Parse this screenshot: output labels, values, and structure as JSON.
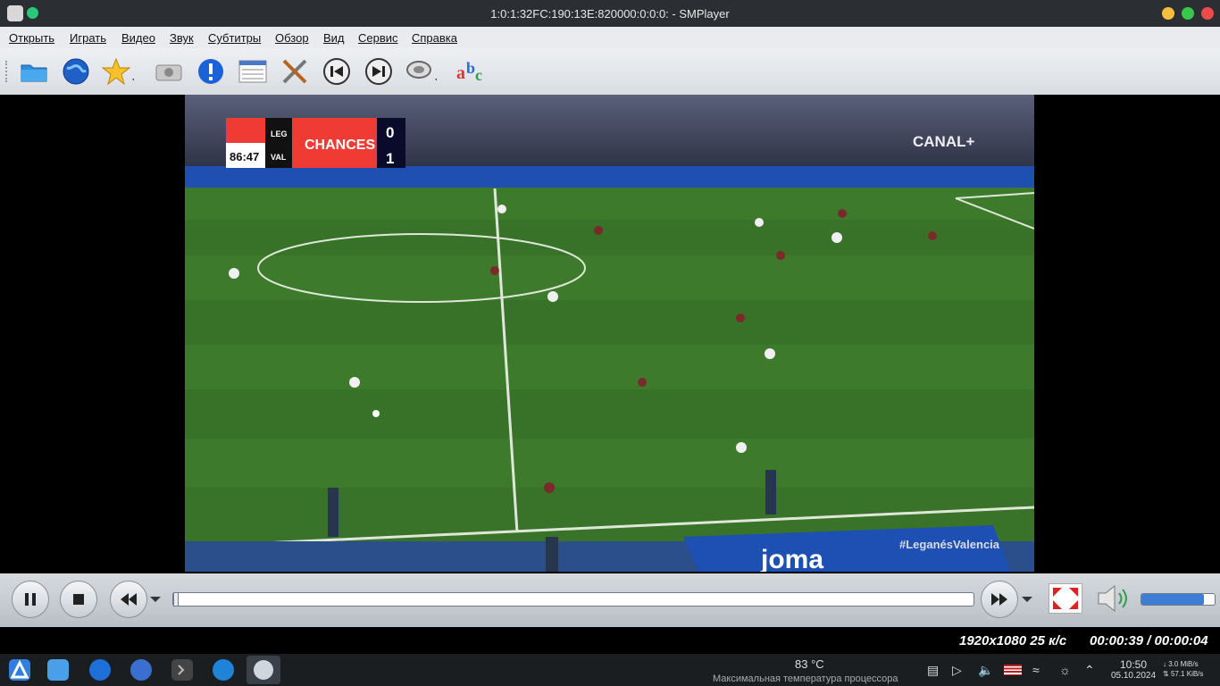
{
  "window": {
    "title": "1:0:1:32FC:190:13E:820000:0:0:0: - SMPlayer"
  },
  "menu": [
    "Открыть",
    "Играть",
    "Видео",
    "Звук",
    "Субтитры",
    "Обзор",
    "Вид",
    "Сервис",
    "Справка"
  ],
  "toolbar": {
    "icons": [
      "folder-icon",
      "globe-icon",
      "favorites-star-icon",
      "screenshot-camera-icon",
      "info-icon",
      "playlist-icon",
      "preferences-tools-icon",
      "previous-track-icon",
      "next-track-icon",
      "audio-track-icon",
      "subtitles-abc-icon"
    ]
  },
  "video": {
    "scoreboard": {
      "time": "86:47",
      "home": "LEG",
      "away": "VAL",
      "banner": "CHANCES",
      "home_score": "0",
      "away_score": "1"
    },
    "broadcaster": "CANAL+",
    "hashtag": "#LeganésValencia",
    "ad": "joma"
  },
  "controls": {
    "progress_fraction": 0.0,
    "volume_fraction": 0.85
  },
  "status": {
    "resolution": "1920x1080 25 к/с",
    "time": "00:00:39 / 00:00:04"
  },
  "taskbar": {
    "weather_temp": "83 °C",
    "weather_desc": "Максимальная температура процессора",
    "clock_time": "10:50",
    "clock_date": "05.10.2024",
    "net_down": "3.0 MiB/s",
    "net_up": "57.1 KiB/s"
  },
  "colors": {
    "accent_green": "#2cc879",
    "score_red": "#ef3b33",
    "joma_blue": "#1e4fb3"
  }
}
